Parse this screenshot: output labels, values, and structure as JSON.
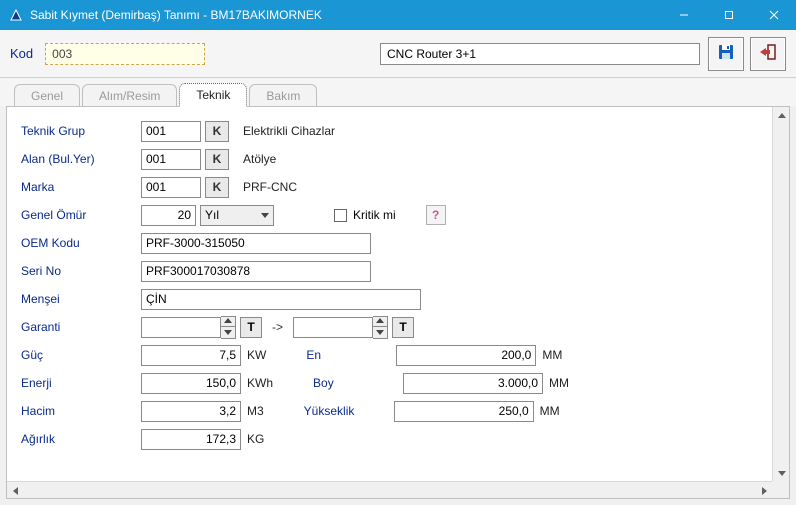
{
  "window": {
    "title": "Sabit Kıymet (Demirbaş) Tanımı - BM17BAKIMORNEK"
  },
  "header": {
    "kod_label": "Kod",
    "kod_value": "003",
    "name_value": "CNC Router 3+1"
  },
  "tabs": {
    "genel": "Genel",
    "alim_resim": "Alım/Resim",
    "teknik": "Teknik",
    "bakim": "Bakım"
  },
  "form": {
    "teknik_grup": {
      "label": "Teknik Grup",
      "value": "001",
      "k": "K",
      "desc": "Elektrikli Cihazlar"
    },
    "alan": {
      "label": "Alan (Bul.Yer)",
      "value": "001",
      "k": "K",
      "desc": "Atölye"
    },
    "marka": {
      "label": "Marka",
      "value": "001",
      "k": "K",
      "desc": "PRF-CNC"
    },
    "genel_omur": {
      "label": "Genel Ömür",
      "value": "20",
      "unit": "Yıl"
    },
    "kritik": {
      "label": "Kritik mi",
      "help": "?"
    },
    "oem": {
      "label": "OEM Kodu",
      "value": "PRF-3000-315050"
    },
    "seri": {
      "label": "Seri No",
      "value": "PRF300017030878"
    },
    "mensei": {
      "label": "Menşei",
      "value": "ÇİN"
    },
    "garanti": {
      "label": "Garanti",
      "t1": "T",
      "arrow": "->",
      "t2": "T",
      "from": "",
      "to": ""
    },
    "guc": {
      "label": "Güç",
      "value": "7,5",
      "unit": "KW"
    },
    "enerji": {
      "label": "Enerji",
      "value": "150,0",
      "unit": "KWh"
    },
    "hacim": {
      "label": "Hacim",
      "value": "3,2",
      "unit": "M3"
    },
    "agirlik": {
      "label": "Ağırlık",
      "value": "172,3",
      "unit": "KG"
    },
    "en": {
      "label": "En",
      "value": "200,0",
      "unit": "MM"
    },
    "boy": {
      "label": "Boy",
      "value": "3.000,0",
      "unit": "MM"
    },
    "yukseklik": {
      "label": "Yükseklik",
      "value": "250,0",
      "unit": "MM"
    }
  }
}
